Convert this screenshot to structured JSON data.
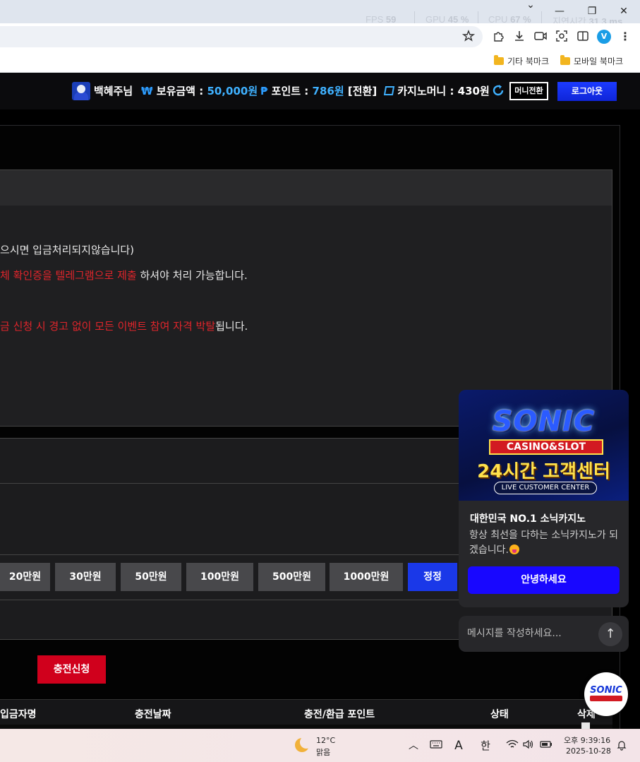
{
  "browser": {
    "perf": [
      {
        "label": "FPS",
        "value": "59"
      },
      {
        "label": "GPU",
        "value": "45 %"
      },
      {
        "label": "CPU",
        "value": "67 %"
      },
      {
        "label": "지연시간",
        "value": "31.3 ms"
      }
    ],
    "window_controls": {
      "minimize": "—",
      "restore": "❐",
      "close": "✕",
      "dropdown": "⌄"
    },
    "toolbar_icons": [
      "star-icon",
      "extensions-icon",
      "download-icon",
      "camera-icon",
      "screenshot-icon",
      "split-view-icon",
      "profile-avatar",
      "menu-icon"
    ],
    "profile_initial": "V",
    "bookmarks": [
      {
        "label": "기타 북마크"
      },
      {
        "label": "모바일 북마크"
      }
    ]
  },
  "header": {
    "username": "백혜주님",
    "balance_symbol": "₩",
    "balance_label": "보유금액 :",
    "balance_value": "50,000원",
    "point_symbol": "₱",
    "point_label": "포인트 :",
    "point_value": "786원",
    "point_convert": "[전환]",
    "casino_label": "카지노머니 : 430원",
    "money_switch": "머니전환",
    "logout": "로그아웃"
  },
  "notice": {
    "line1": "으시면 입금처리되지않습니다)",
    "line2_red": "체 확인증을 텔레그램으로 제출",
    "line2_rest": " 하셔야 처리 가능합니다.",
    "line3_red": "금 신청 시 경고 없이 모든 이벤트 참여 자격 박탈",
    "line3_rest": "됩니다."
  },
  "amount_buttons": [
    "20만원",
    "30만원",
    "50만원",
    "100만원",
    "500만원",
    "1000만원"
  ],
  "reset_label": "정정",
  "submit_label": "충전신청",
  "table_headers": [
    "입금자명",
    "충전날짜",
    "충전/환급 포인트",
    "상태",
    "삭제"
  ],
  "chat": {
    "banner_brand": "SONIC",
    "banner_casino": "CASINO&SLOT",
    "banner_headline": "24시간 고객센터",
    "banner_sub": "LIVE CUSTOMER CENTER",
    "title": "대한민국 NO.1 소닉카지노",
    "description": "항상 최선을 다하는 소닉카지노가 되겠습니다.",
    "hello_button": "안녕하세요",
    "input_placeholder": "메시지를 작성하세요...",
    "send_icon": "↑",
    "launcher_logo": "SONIC"
  },
  "taskbar": {
    "temperature": "12°C",
    "weather": "맑음",
    "ime_a": "A",
    "ime_han": "한",
    "time": "오후 9:39:16",
    "date": "2025-10-28"
  }
}
